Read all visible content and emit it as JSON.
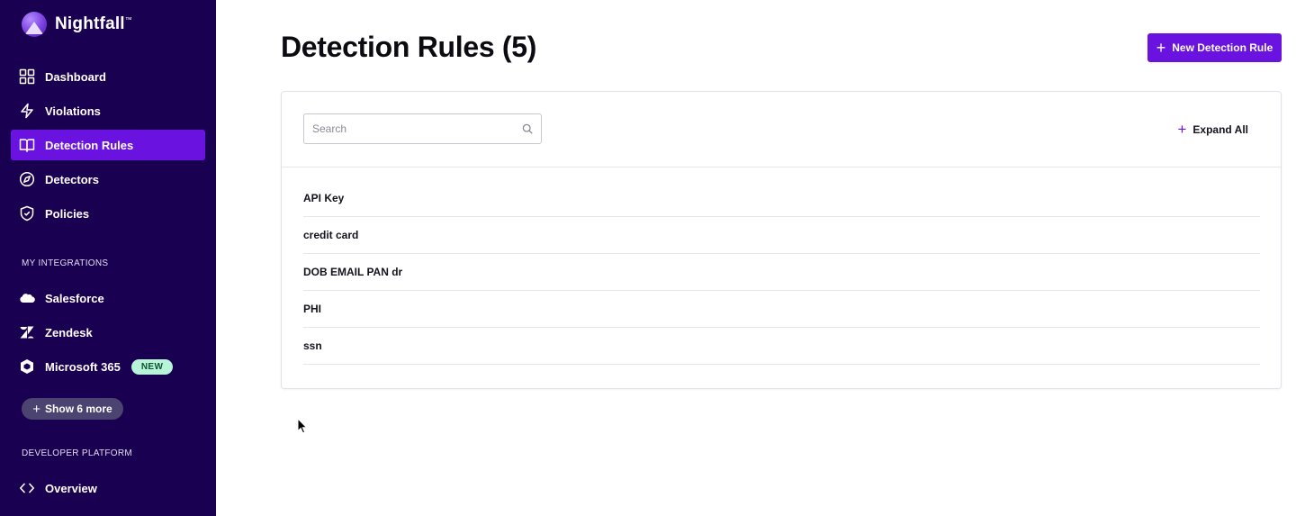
{
  "brand": {
    "name": "Nightfall",
    "tm": "™"
  },
  "nav": {
    "items": [
      {
        "label": "Dashboard",
        "icon": "grid-icon"
      },
      {
        "label": "Violations",
        "icon": "lightning-icon"
      },
      {
        "label": "Detection Rules",
        "icon": "book-icon",
        "active": true
      },
      {
        "label": "Detectors",
        "icon": "compass-icon"
      },
      {
        "label": "Policies",
        "icon": "shield-check-icon"
      }
    ]
  },
  "integrations": {
    "title": "MY INTEGRATIONS",
    "items": [
      {
        "label": "Salesforce",
        "icon": "cloud-icon"
      },
      {
        "label": "Zendesk",
        "icon": "zendesk-icon"
      },
      {
        "label": "Microsoft 365",
        "icon": "office-hexagon-icon",
        "badge": "NEW"
      }
    ],
    "show_more": "Show 6 more"
  },
  "developer": {
    "title": "DEVELOPER PLATFORM",
    "items": [
      {
        "label": "Overview",
        "icon": "code-icon"
      }
    ]
  },
  "main": {
    "title": "Detection Rules (5)",
    "new_button": "New Detection Rule",
    "search_placeholder": "Search",
    "expand_all": "Expand All",
    "rules": [
      "API Key",
      "credit card",
      "DOB EMAIL PAN dr",
      "PHI",
      "ssn"
    ]
  },
  "colors": {
    "sidebar_bg": "#1a0050",
    "accent": "#6a13e0",
    "badge_bg": "#b8f5d8"
  }
}
